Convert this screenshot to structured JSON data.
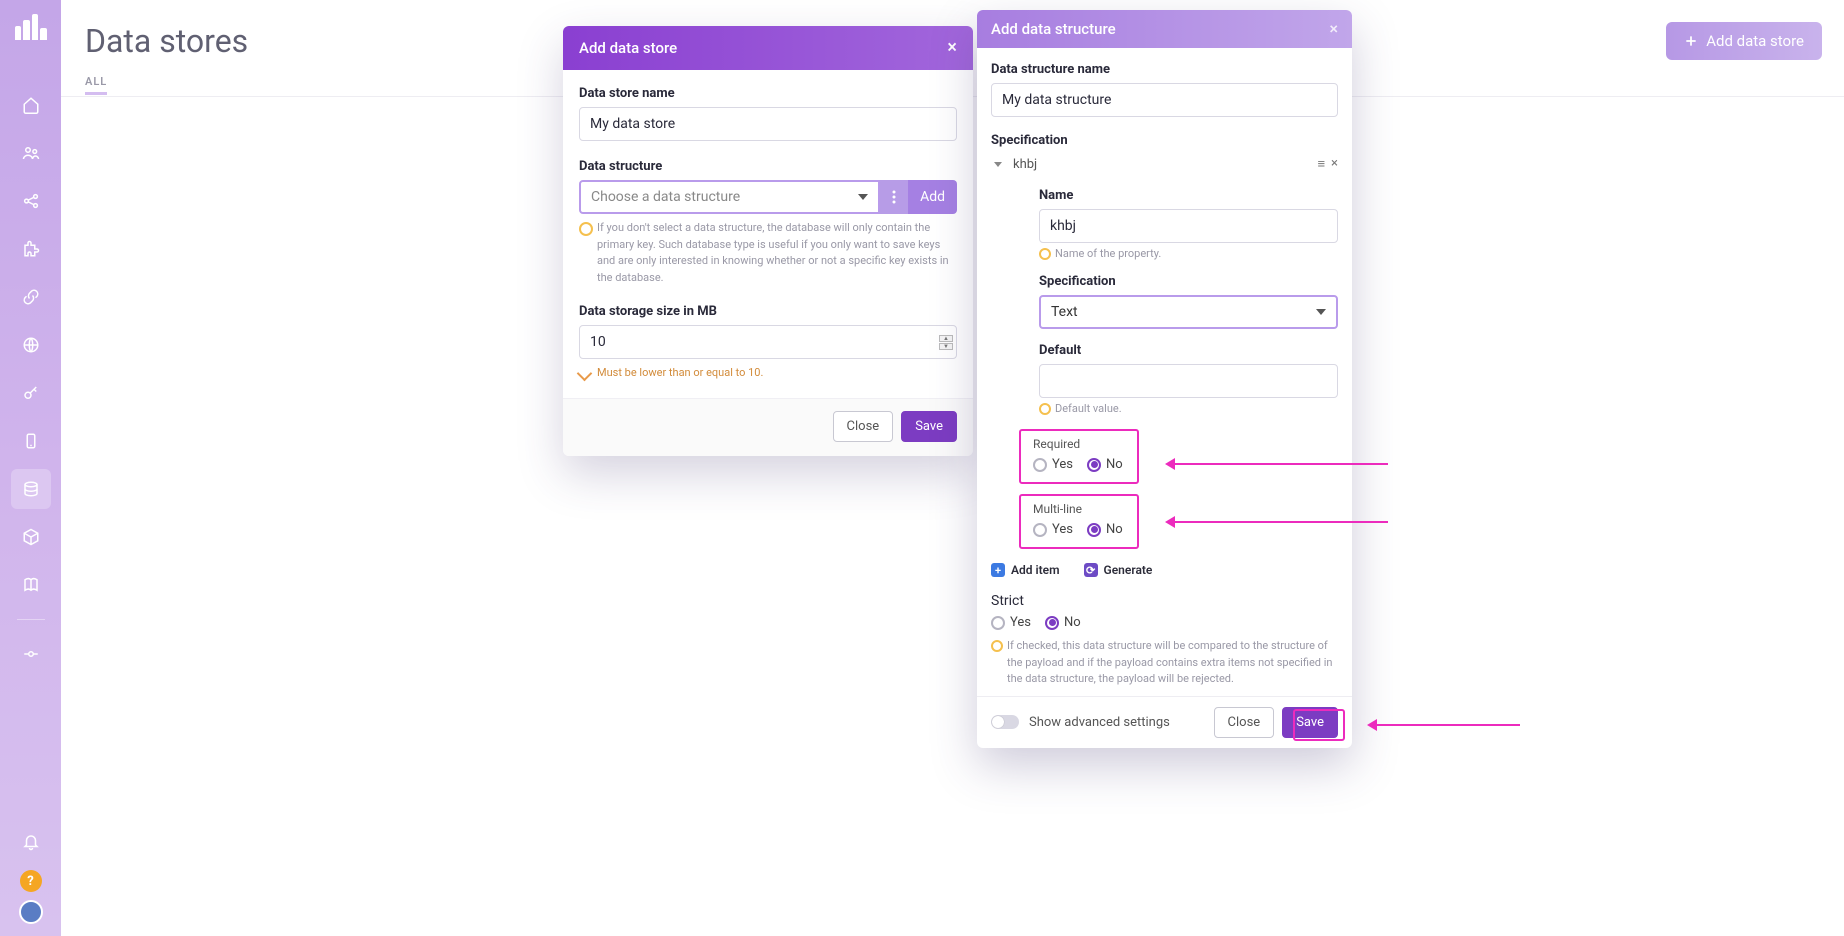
{
  "page": {
    "title": "Data stores",
    "filter_tab": "ALL",
    "add_store_btn": "Add data store"
  },
  "sidebar": {
    "items": [
      {
        "name": "home-icon"
      },
      {
        "name": "users-icon"
      },
      {
        "name": "share-icon"
      },
      {
        "name": "puzzle-icon"
      },
      {
        "name": "link-icon"
      },
      {
        "name": "globe-icon"
      },
      {
        "name": "key-icon"
      },
      {
        "name": "mobile-icon"
      },
      {
        "name": "database-icon",
        "active": true
      },
      {
        "name": "cube-icon"
      },
      {
        "name": "book-icon"
      },
      {
        "name": "commit-icon"
      }
    ]
  },
  "modal1": {
    "title": "Add data store",
    "fields": {
      "name_label": "Data store name",
      "name_value": "My data store",
      "structure_label": "Data structure",
      "structure_placeholder": "Choose a data structure",
      "structure_add": "Add",
      "structure_hint": "If you don't select a data structure, the database will only contain the primary key. Such database type is useful if you only want to save keys and are only interested in knowing whether or not a specific key exists in the database.",
      "size_label": "Data storage size in MB",
      "size_value": "10",
      "size_hint": "Must be lower than or equal to 10."
    },
    "footer": {
      "close": "Close",
      "save": "Save"
    }
  },
  "modal2": {
    "title": "Add data structure",
    "name_label": "Data structure name",
    "name_value": "My data structure",
    "spec_label": "Specification",
    "item": {
      "title": "khbj",
      "name_label": "Name",
      "name_value": "khbj",
      "name_hint": "Name of the property.",
      "spec_label": "Specification",
      "spec_value": "Text",
      "default_label": "Default",
      "default_value": "",
      "default_hint": "Default value.",
      "required_label": "Required",
      "multiline_label": "Multi-line",
      "yes": "Yes",
      "no": "No"
    },
    "actions": {
      "add_item": "Add item",
      "generate": "Generate"
    },
    "strict": {
      "label": "Strict",
      "yes": "Yes",
      "no": "No",
      "hint": "If checked, this data structure will be compared to the structure of the payload and if the payload contains extra items not specified in the data structure, the payload will be rejected."
    },
    "footer": {
      "advanced": "Show advanced settings",
      "close": "Close",
      "save": "Save"
    }
  }
}
